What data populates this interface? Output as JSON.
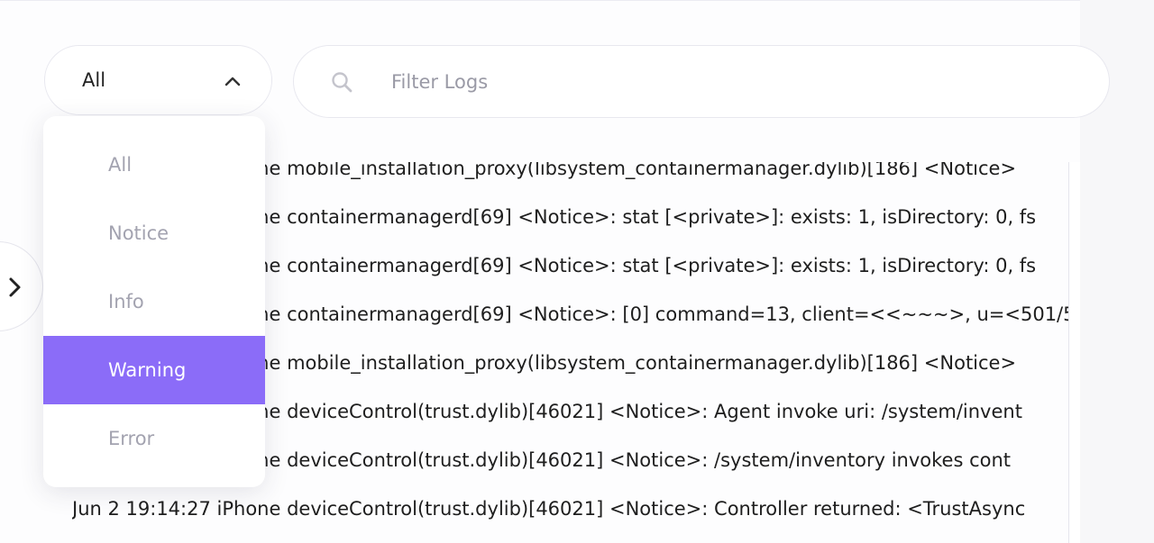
{
  "filter": {
    "selected_level": "All",
    "search_placeholder": "Filter Logs",
    "search_value": ""
  },
  "dropdown": {
    "options": [
      "All",
      "Notice",
      "Info",
      "Warning",
      "Error"
    ],
    "highlighted": "Warning"
  },
  "logs": [
    "Jun 2 19:14:27 iPhone mobile_installation_proxy(libsystem_containermanager.dylib)[186] <Notice>",
    "Jun 2 19:14:27 iPhone containermanagerd[69] <Notice>: stat [<private>]: exists: 1, isDirectory: 0, fs",
    "Jun 2 19:14:27 iPhone containermanagerd[69] <Notice>: stat [<private>]: exists: 1, isDirectory: 0, fs",
    "Jun 2 19:14:27 iPhone containermanagerd[69] <Notice>: [0] command=13, client=<<~~~>, u=<501/5",
    "Jun 2 19:14:27 iPhone mobile_installation_proxy(libsystem_containermanager.dylib)[186] <Notice>",
    "Jun 2 19:14:27 iPhone deviceControl(trust.dylib)[46021] <Notice>: Agent invoke uri: /system/invent",
    "Jun 2 19:14:27 iPhone deviceControl(trust.dylib)[46021] <Notice>: /system/inventory invokes cont",
    "Jun 2 19:14:27 iPhone deviceControl(trust.dylib)[46021] <Notice>: Controller returned: <TrustAsync"
  ],
  "colors": {
    "accent": "#8b6cf8",
    "option_text": "#a3a3b0",
    "log_text": "#1e1e1e",
    "border": "#e8e8ef"
  },
  "icons": {
    "level_select": "chevron-up-icon",
    "search": "search-icon",
    "side_toggle": "chevron-right-icon"
  }
}
